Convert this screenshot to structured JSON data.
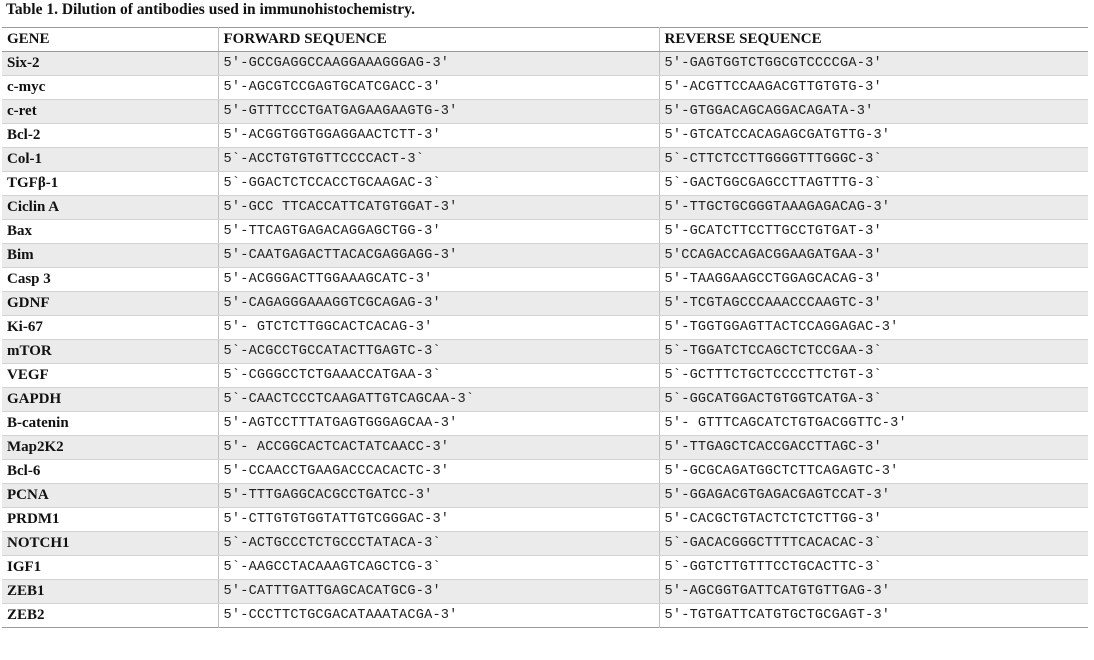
{
  "caption": "Table 1.  Dilution of antibodies used in immunohistochemistry.",
  "headers": [
    "GENE",
    "FORWARD SEQUENCE",
    "REVERSE SEQUENCE"
  ],
  "rows": [
    [
      "Six-2",
      "5′-GCCGAGGCCAAGGAAAGGGAG-3′",
      "5′-GAGTGGTCTGGCGTCCCCGA-3′"
    ],
    [
      "c-myc",
      "5′-AGCGTCCGAGTGCATCGACC-3′",
      "5′-ACGTTCCAAGACGTTGTGTG-3′"
    ],
    [
      "c-ret",
      "5′-GTTTCCCTGATGAGAAGAAGTG-3′",
      "5′-GTGGACAGCAGGACAGATA-3′"
    ],
    [
      "Bcl-2",
      "5′-ACGGTGGTGGAGGAACTCTT-3′",
      "5′-GTCATCCACAGAGCGATGTTG-3′"
    ],
    [
      "Col-1",
      "5`-ACCTGTGTGTTCCCCACT-3`",
      "5`-CTTCTCCTTGGGGTTTGGGC-3`"
    ],
    [
      "TGFβ-1",
      "5`-GGACTCTCCACCTGCAAGAC-3`",
      "5`-GACTGGCGAGCCTTAGTTTG-3`"
    ],
    [
      "Ciclin A",
      "5′-GCC TTCACCATTCATGTGGAT-3′",
      "5′-TTGCTGCGGGTAAAGAGACAG-3′"
    ],
    [
      "Bax",
      "5′-TTCAGTGAGACAGGAGCTGG-3′",
      "5′-GCATCTTCCTTGCCTGTGAT-3′"
    ],
    [
      "Bim",
      "5′-CAATGAGACTTACACGAGGAGG-3′",
      "5′CCAGACCAGACGGAAGATGAA-3′"
    ],
    [
      "Casp 3",
      "5′-ACGGGACTTGGAAAGCATC-3′",
      "5′-TAAGGAAGCCTGGAGCACAG-3′"
    ],
    [
      "GDNF",
      "5′-CAGAGGGAAAGGTCGCAGAG-3′",
      "5′-TCGTAGCCCAAACCCAAGTC-3′"
    ],
    [
      "Ki-67",
      "5′- GTCTCTTGGCACTCACAG-3′",
      "5′-TGGTGGAGTTACTCCAGGAGAC-3′"
    ],
    [
      "mTOR",
      "5`-ACGCCTGCCATACTTGAGTC-3`",
      "5`-TGGATCTCCAGCTCTCCGAA-3`"
    ],
    [
      "VEGF",
      "5`-CGGGCCTCTGAAACCATGAA-3`",
      "5`-GCTTTCTGCTCCCCTTCTGT-3`"
    ],
    [
      "GAPDH",
      "5`-CAACTCCCTCAAGATTGTCAGCAA-3`",
      "5`-GGCATGGACTGTGGTCATGA-3`"
    ],
    [
      "B-catenin",
      "5′-AGTCCTTTATGAGTGGGAGCAA-3′",
      "5′- GTTTCAGCATCTGTGACGGTTC-3′"
    ],
    [
      "Map2K2",
      "5′- ACCGGCACTCACTATCAACC-3′",
      "5′-TTGAGCTCACCGACCTTAGC-3′"
    ],
    [
      "Bcl-6",
      "5′-CCAACCTGAAGACCCACACTC-3′",
      "5′-GCGCAGATGGCTCTTCAGAGTC-3′"
    ],
    [
      "PCNA",
      "5′-TTTGAGGCACGCCTGATCC-3′",
      "5′-GGAGACGTGAGACGAGTCCAT-3′"
    ],
    [
      "PRDM1",
      "5′-CTTGTGTGGTATTGTCGGGAC-3′",
      "5′-CACGCTGTACTCTCTCTTGG-3′"
    ],
    [
      "NOTCH1",
      "5`-ACTGCCCTCTGCCCTATACA-3`",
      "5`-GACACGGGCTTTTCACACAC-3`"
    ],
    [
      "IGF1",
      "5`-AAGCCTACAAAGTCAGCTCG-3`",
      "5`-GGTCTTGTTTCCTGCACTTC-3`"
    ],
    [
      "ZEB1",
      "5′-CATTTGATTGAGCACATGCG-3′",
      "5′-AGCGGTGATTCATGTGTTGAG-3′"
    ],
    [
      "ZEB2",
      "5′-CCCTTCTGCGACATAAATACGA-3′",
      "5′-TGTGATTCATGTGCTGCGAGT-3′"
    ]
  ]
}
